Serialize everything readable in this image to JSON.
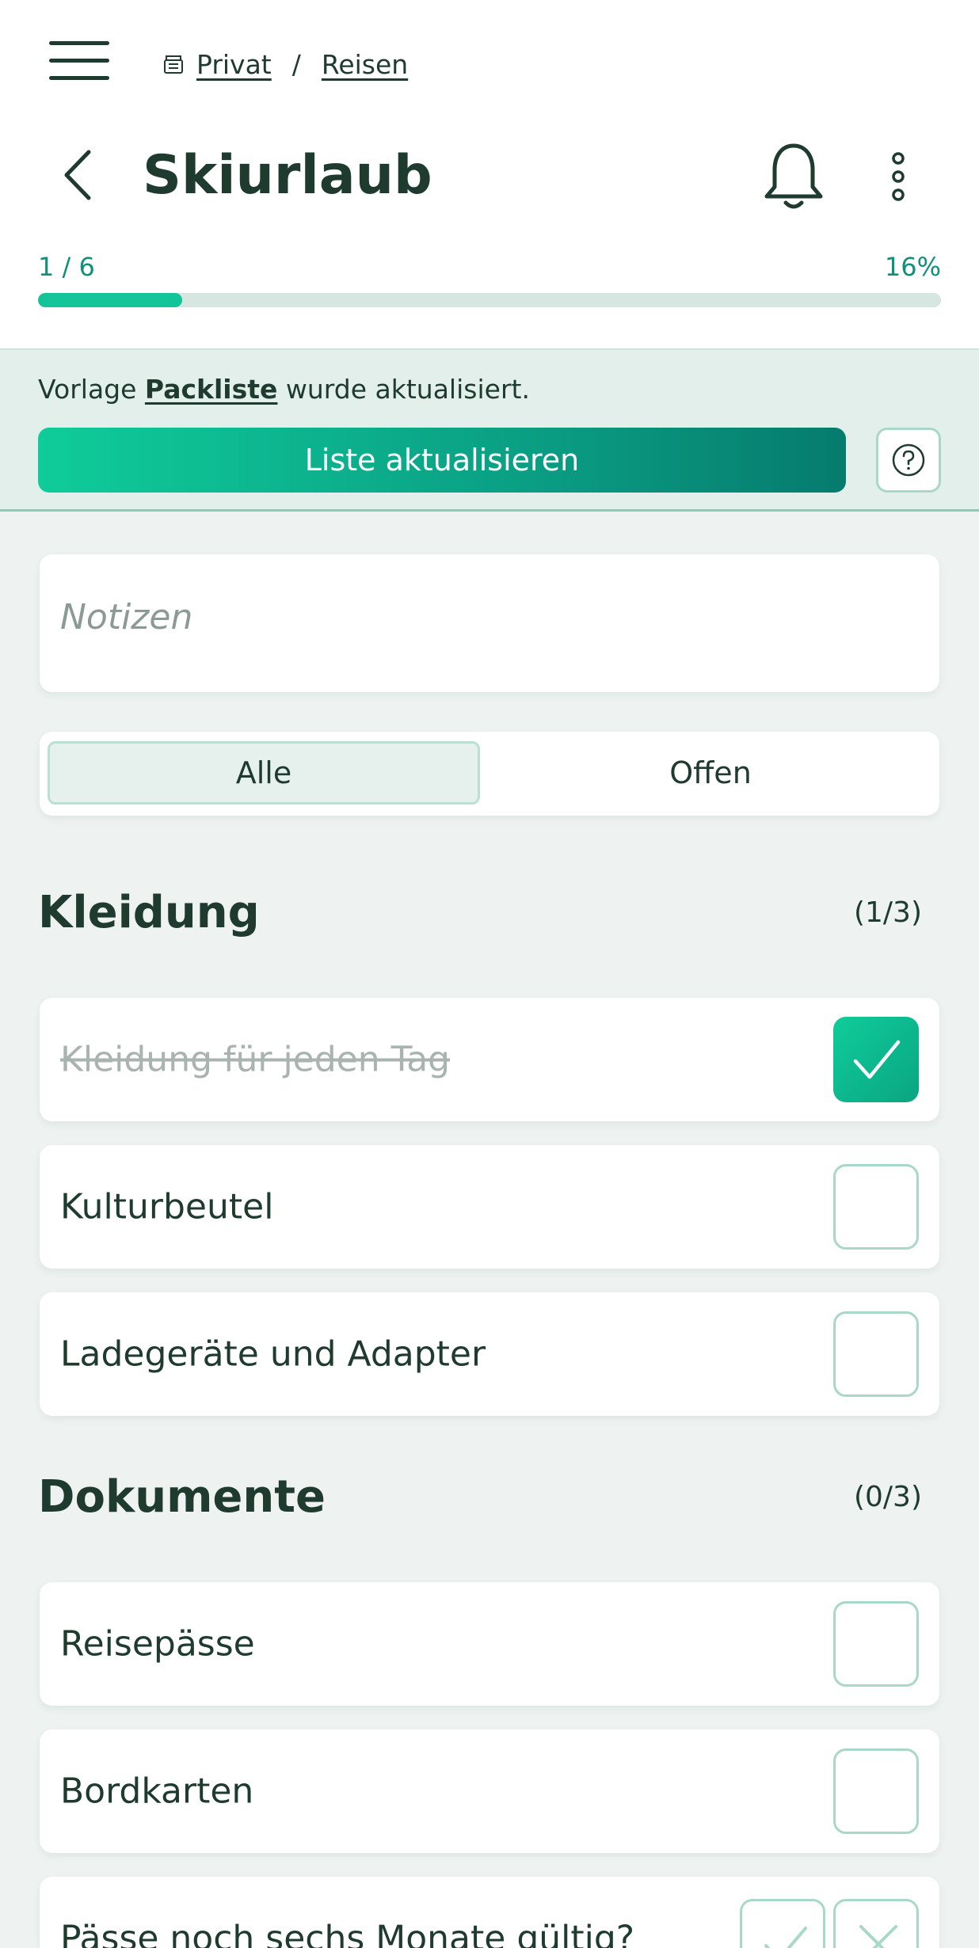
{
  "breadcrumb": {
    "home_label": "Privat",
    "separator": "/",
    "current_label": "Reisen"
  },
  "header": {
    "title": "Skiurlaub"
  },
  "progress": {
    "count_text": "1 / 6",
    "percent_text": "16%",
    "fraction": 0.16
  },
  "banner": {
    "text_before": "Vorlage ",
    "template_link": "Packliste",
    "text_after": " wurde aktualisiert.",
    "update_button": "Liste aktualisieren",
    "help_icon": "question-circle-icon"
  },
  "notes": {
    "placeholder": "Notizen"
  },
  "filter": {
    "all_label": "Alle",
    "open_label": "Offen",
    "selected": "Alle"
  },
  "sections": [
    {
      "title": "Kleidung",
      "count": "(1/3)",
      "items": [
        {
          "label": "Kleidung für jeden Tag",
          "checked": true
        },
        {
          "label": "Kulturbeutel",
          "checked": false
        },
        {
          "label": "Ladegeräte und Adapter",
          "checked": false
        }
      ]
    },
    {
      "title": "Dokumente",
      "count": "(0/3)",
      "items": [
        {
          "label": "Reisepässe",
          "checked": false
        },
        {
          "label": "Bordkarten",
          "checked": false
        },
        {
          "label": "Pässe noch sechs Monate gültig?",
          "checked": false
        }
      ]
    }
  ],
  "colors": {
    "accent": "#0fcc9a",
    "accent_dark": "#067b6e",
    "text": "#1f3a2e",
    "background": "#eef3f1"
  }
}
